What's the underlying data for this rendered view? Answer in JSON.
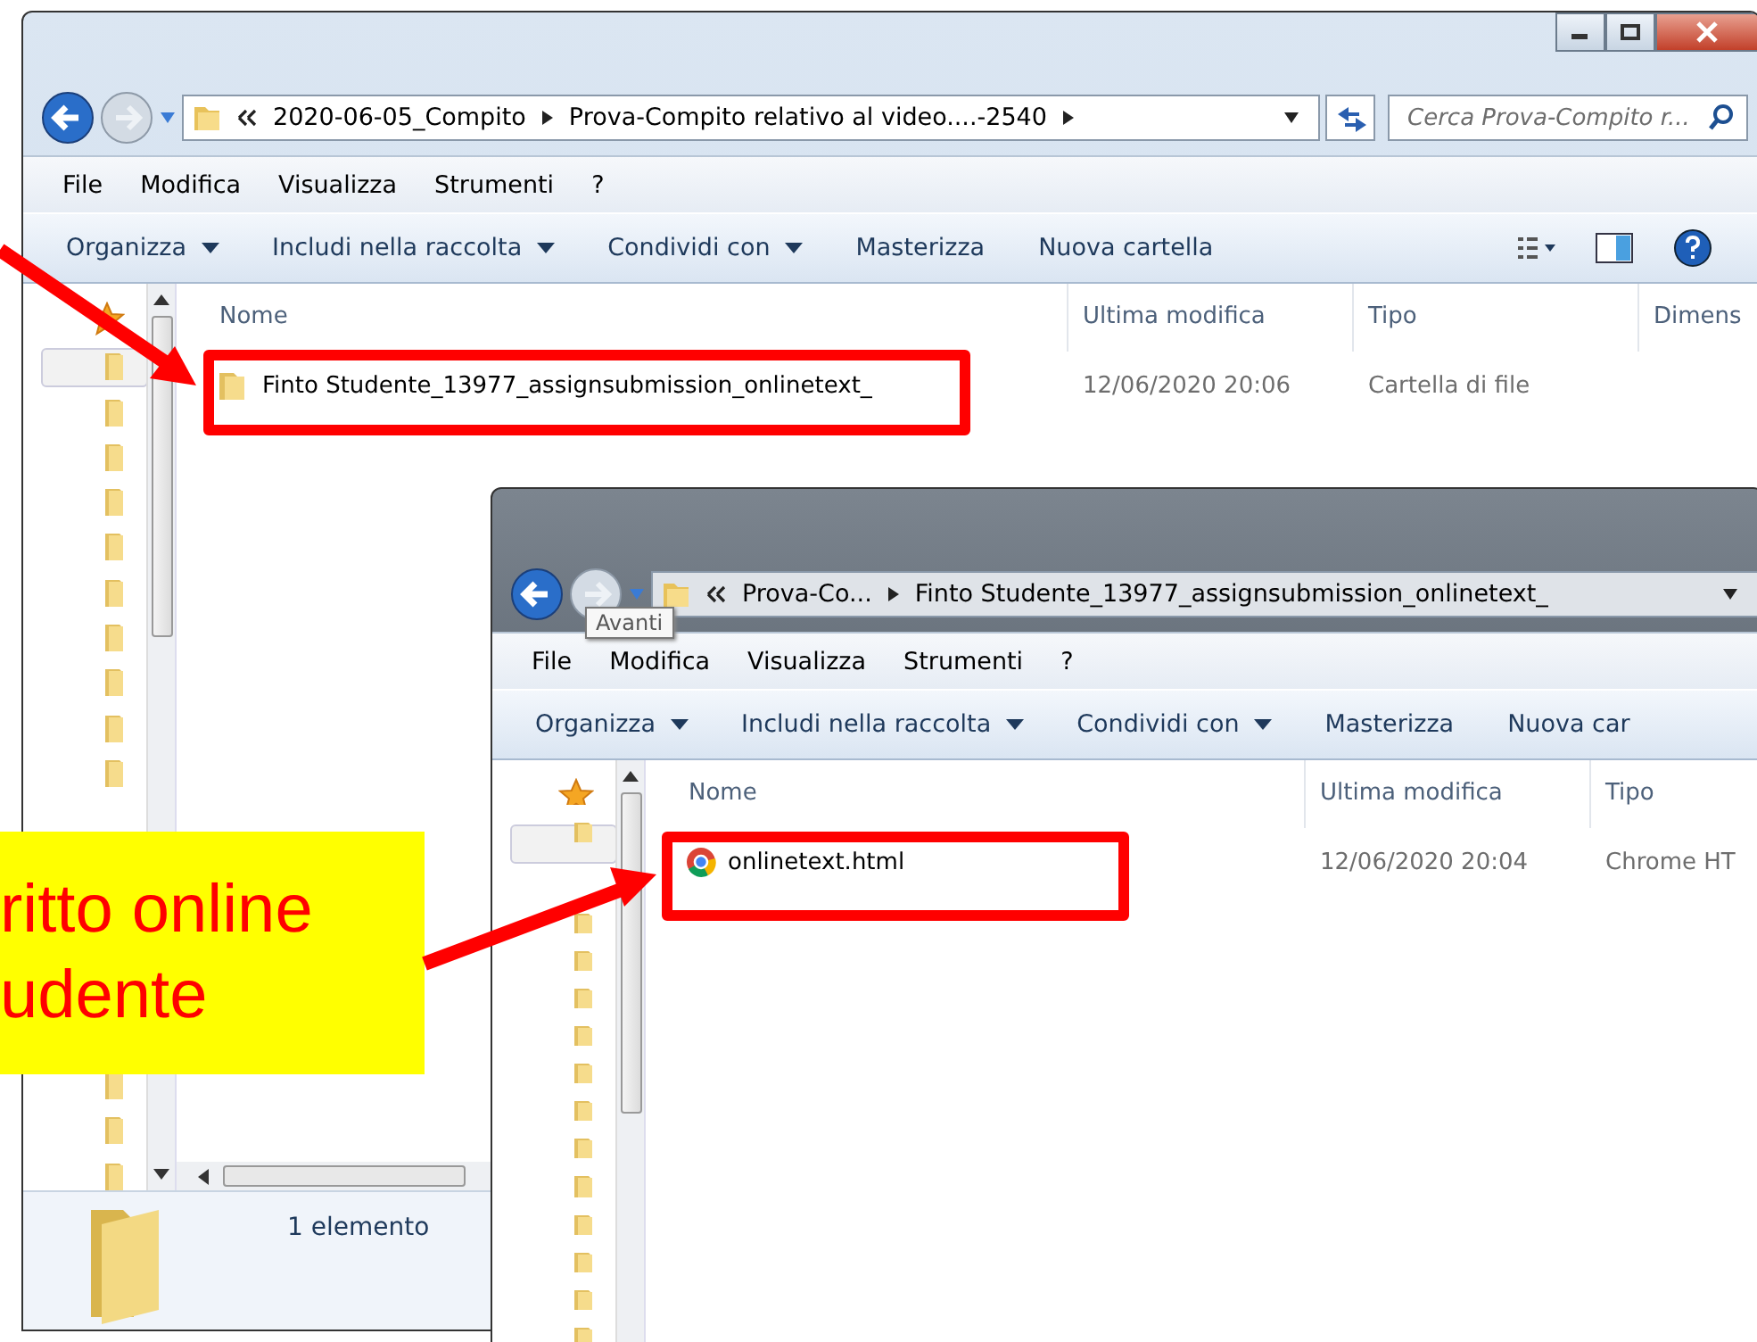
{
  "windows": [
    {
      "address": {
        "crumbs": [
          "2020-06-05_Compito",
          "Prova-Compito relativo al video....-2540"
        ]
      },
      "search": {
        "placeholder": "Cerca Prova-Compito r..."
      },
      "menu": [
        "File",
        "Modifica",
        "Visualizza",
        "Strumenti",
        "?"
      ],
      "toolbar": [
        {
          "label": "Organizza",
          "has_menu": true
        },
        {
          "label": "Includi nella raccolta",
          "has_menu": true
        },
        {
          "label": "Condividi con",
          "has_menu": true
        },
        {
          "label": "Masterizza",
          "has_menu": false
        },
        {
          "label": "Nuova cartella",
          "has_menu": false
        }
      ],
      "columns": [
        "Nome",
        "Ultima modifica",
        "Tipo",
        "Dimens"
      ],
      "rows": [
        {
          "kind": "folder",
          "cells": [
            "Finto Studente_13977_assignsubmission_onlinetext_",
            "12/06/2020 20:06",
            "Cartella di file"
          ]
        }
      ],
      "status": "1 elemento"
    },
    {
      "address": {
        "crumbs": [
          "Prova-Co...",
          "Finto Studente_13977_assignsubmission_onlinetext_"
        ]
      },
      "tooltip": "Avanti",
      "menu": [
        "File",
        "Modifica",
        "Visualizza",
        "Strumenti",
        "?"
      ],
      "toolbar": [
        {
          "label": "Organizza",
          "has_menu": true
        },
        {
          "label": "Includi nella raccolta",
          "has_menu": true
        },
        {
          "label": "Condividi con",
          "has_menu": true
        },
        {
          "label": "Masterizza",
          "has_menu": false
        },
        {
          "label": "Nuova car",
          "has_menu": false
        }
      ],
      "columns": [
        "Nome",
        "Ultima modifica",
        "Tipo"
      ],
      "rows": [
        {
          "kind": "chrome",
          "cells": [
            "onlinetext.html",
            "12/06/2020 20:04",
            "Chrome HT"
          ]
        }
      ]
    }
  ],
  "callout": {
    "lines": [
      "ritto online",
      "udente"
    ]
  }
}
